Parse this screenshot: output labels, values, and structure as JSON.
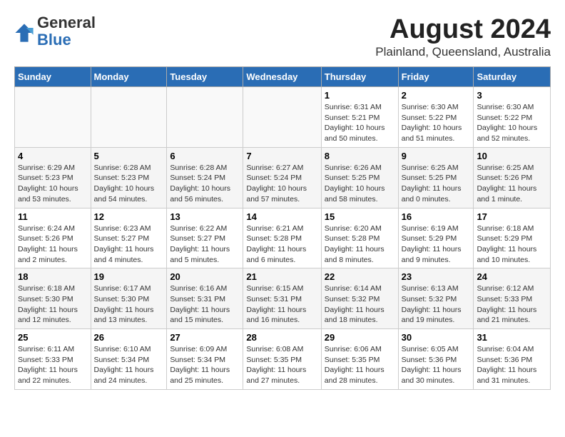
{
  "header": {
    "logo": {
      "general": "General",
      "blue": "Blue"
    },
    "title": "August 2024",
    "subtitle": "Plainland, Queensland, Australia"
  },
  "weekdays": [
    "Sunday",
    "Monday",
    "Tuesday",
    "Wednesday",
    "Thursday",
    "Friday",
    "Saturday"
  ],
  "weeks": [
    [
      {
        "day": "",
        "info": ""
      },
      {
        "day": "",
        "info": ""
      },
      {
        "day": "",
        "info": ""
      },
      {
        "day": "",
        "info": ""
      },
      {
        "day": "1",
        "info": "Sunrise: 6:31 AM\nSunset: 5:21 PM\nDaylight: 10 hours and 50 minutes."
      },
      {
        "day": "2",
        "info": "Sunrise: 6:30 AM\nSunset: 5:22 PM\nDaylight: 10 hours and 51 minutes."
      },
      {
        "day": "3",
        "info": "Sunrise: 6:30 AM\nSunset: 5:22 PM\nDaylight: 10 hours and 52 minutes."
      }
    ],
    [
      {
        "day": "4",
        "info": "Sunrise: 6:29 AM\nSunset: 5:23 PM\nDaylight: 10 hours and 53 minutes."
      },
      {
        "day": "5",
        "info": "Sunrise: 6:28 AM\nSunset: 5:23 PM\nDaylight: 10 hours and 54 minutes."
      },
      {
        "day": "6",
        "info": "Sunrise: 6:28 AM\nSunset: 5:24 PM\nDaylight: 10 hours and 56 minutes."
      },
      {
        "day": "7",
        "info": "Sunrise: 6:27 AM\nSunset: 5:24 PM\nDaylight: 10 hours and 57 minutes."
      },
      {
        "day": "8",
        "info": "Sunrise: 6:26 AM\nSunset: 5:25 PM\nDaylight: 10 hours and 58 minutes."
      },
      {
        "day": "9",
        "info": "Sunrise: 6:25 AM\nSunset: 5:25 PM\nDaylight: 11 hours and 0 minutes."
      },
      {
        "day": "10",
        "info": "Sunrise: 6:25 AM\nSunset: 5:26 PM\nDaylight: 11 hours and 1 minute."
      }
    ],
    [
      {
        "day": "11",
        "info": "Sunrise: 6:24 AM\nSunset: 5:26 PM\nDaylight: 11 hours and 2 minutes."
      },
      {
        "day": "12",
        "info": "Sunrise: 6:23 AM\nSunset: 5:27 PM\nDaylight: 11 hours and 4 minutes."
      },
      {
        "day": "13",
        "info": "Sunrise: 6:22 AM\nSunset: 5:27 PM\nDaylight: 11 hours and 5 minutes."
      },
      {
        "day": "14",
        "info": "Sunrise: 6:21 AM\nSunset: 5:28 PM\nDaylight: 11 hours and 6 minutes."
      },
      {
        "day": "15",
        "info": "Sunrise: 6:20 AM\nSunset: 5:28 PM\nDaylight: 11 hours and 8 minutes."
      },
      {
        "day": "16",
        "info": "Sunrise: 6:19 AM\nSunset: 5:29 PM\nDaylight: 11 hours and 9 minutes."
      },
      {
        "day": "17",
        "info": "Sunrise: 6:18 AM\nSunset: 5:29 PM\nDaylight: 11 hours and 10 minutes."
      }
    ],
    [
      {
        "day": "18",
        "info": "Sunrise: 6:18 AM\nSunset: 5:30 PM\nDaylight: 11 hours and 12 minutes."
      },
      {
        "day": "19",
        "info": "Sunrise: 6:17 AM\nSunset: 5:30 PM\nDaylight: 11 hours and 13 minutes."
      },
      {
        "day": "20",
        "info": "Sunrise: 6:16 AM\nSunset: 5:31 PM\nDaylight: 11 hours and 15 minutes."
      },
      {
        "day": "21",
        "info": "Sunrise: 6:15 AM\nSunset: 5:31 PM\nDaylight: 11 hours and 16 minutes."
      },
      {
        "day": "22",
        "info": "Sunrise: 6:14 AM\nSunset: 5:32 PM\nDaylight: 11 hours and 18 minutes."
      },
      {
        "day": "23",
        "info": "Sunrise: 6:13 AM\nSunset: 5:32 PM\nDaylight: 11 hours and 19 minutes."
      },
      {
        "day": "24",
        "info": "Sunrise: 6:12 AM\nSunset: 5:33 PM\nDaylight: 11 hours and 21 minutes."
      }
    ],
    [
      {
        "day": "25",
        "info": "Sunrise: 6:11 AM\nSunset: 5:33 PM\nDaylight: 11 hours and 22 minutes."
      },
      {
        "day": "26",
        "info": "Sunrise: 6:10 AM\nSunset: 5:34 PM\nDaylight: 11 hours and 24 minutes."
      },
      {
        "day": "27",
        "info": "Sunrise: 6:09 AM\nSunset: 5:34 PM\nDaylight: 11 hours and 25 minutes."
      },
      {
        "day": "28",
        "info": "Sunrise: 6:08 AM\nSunset: 5:35 PM\nDaylight: 11 hours and 27 minutes."
      },
      {
        "day": "29",
        "info": "Sunrise: 6:06 AM\nSunset: 5:35 PM\nDaylight: 11 hours and 28 minutes."
      },
      {
        "day": "30",
        "info": "Sunrise: 6:05 AM\nSunset: 5:36 PM\nDaylight: 11 hours and 30 minutes."
      },
      {
        "day": "31",
        "info": "Sunrise: 6:04 AM\nSunset: 5:36 PM\nDaylight: 11 hours and 31 minutes."
      }
    ]
  ]
}
